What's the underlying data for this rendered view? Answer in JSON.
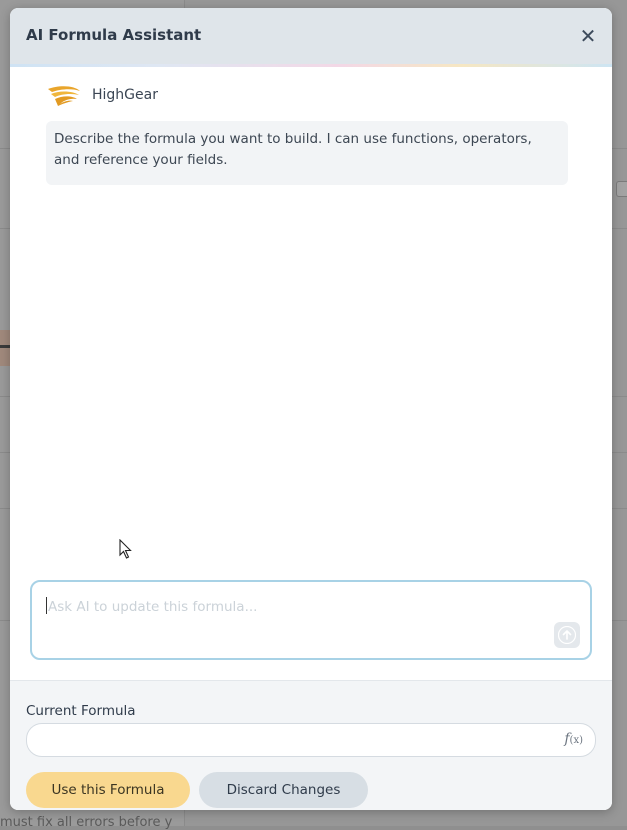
{
  "background": {
    "footer_text": "must fix all errors before y"
  },
  "dialog": {
    "title": "AI Formula Assistant",
    "close_glyph": "✕"
  },
  "assistant": {
    "name": "HighGear",
    "logo_icon": "highgear-logo-icon",
    "message": "Describe the formula you want to build. I can use functions, operators, and reference your fields."
  },
  "chat_input": {
    "value": "",
    "placeholder": "Ask AI to update this formula...",
    "send_icon": "arrow-up-icon"
  },
  "current_formula": {
    "label": "Current Formula",
    "value": "",
    "fx_main": "f",
    "fx_sub": "(x)"
  },
  "actions": {
    "use_label": "Use this Formula",
    "discard_label": "Discard Changes"
  },
  "colors": {
    "accent_yellow": "#f9d88f",
    "input_border": "#a8d2e6",
    "header_bg": "#dfe5ea"
  }
}
